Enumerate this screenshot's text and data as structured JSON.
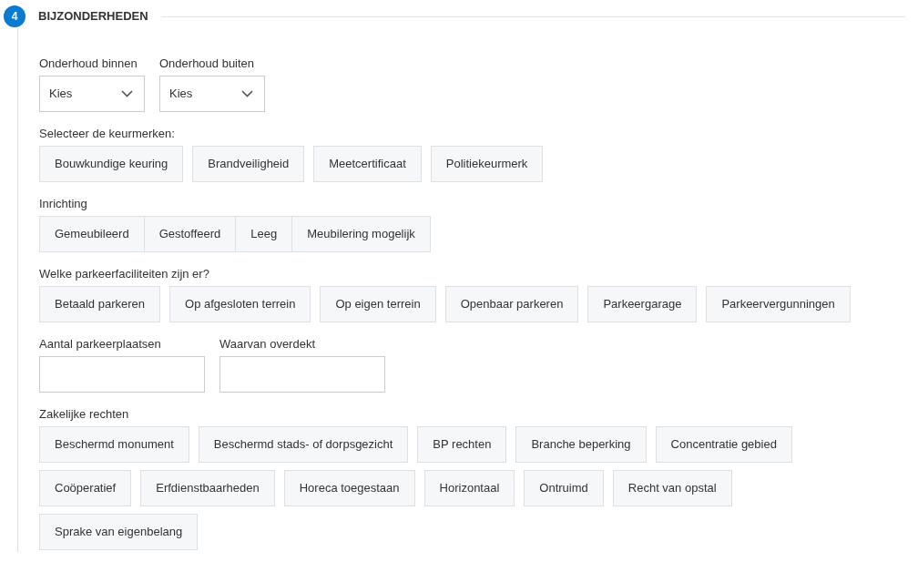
{
  "step": {
    "number": "4",
    "title": "BIJZONDERHEDEN"
  },
  "sections": [
    {
      "kind": "selects",
      "fields": [
        {
          "label": "Onderhoud binnen",
          "value": "Kies"
        },
        {
          "label": "Onderhoud buiten",
          "value": "Kies"
        }
      ]
    },
    {
      "kind": "options",
      "label": "Selecteer de keurmerken:",
      "joined": false,
      "options": [
        {
          "text": "Bouwkundige keuring",
          "selected": false
        },
        {
          "text": "Brandveiligheid",
          "selected": false
        },
        {
          "text": "Meetcertificaat",
          "selected": false
        },
        {
          "text": "Politiekeurmerk",
          "selected": false
        }
      ]
    },
    {
      "kind": "options",
      "label": "Inrichting",
      "joined": true,
      "options": [
        {
          "text": "Gemeubileerd",
          "selected": false
        },
        {
          "text": "Gestoffeerd",
          "selected": false
        },
        {
          "text": "Leeg",
          "selected": false
        },
        {
          "text": "Meubilering mogelijk",
          "selected": false
        }
      ]
    },
    {
      "kind": "options",
      "label": "Welke parkeerfaciliteiten zijn er?",
      "joined": false,
      "options": [
        {
          "text": "Betaald parkeren",
          "selected": false
        },
        {
          "text": "Op afgesloten terrein",
          "selected": false
        },
        {
          "text": "Op eigen terrein",
          "selected": false
        },
        {
          "text": "Openbaar parkeren",
          "selected": false
        },
        {
          "text": "Parkeergarage",
          "selected": false
        },
        {
          "text": "Parkeervergunningen",
          "selected": false
        }
      ]
    },
    {
      "kind": "inputs",
      "fields": [
        {
          "label": "Aantal parkeerplaatsen"
        },
        {
          "label": "Waarvan overdekt"
        }
      ]
    },
    {
      "kind": "options",
      "label": "Zakelijke rechten",
      "joined": false,
      "options": [
        {
          "text": "Beschermd monument",
          "selected": false
        },
        {
          "text": "Beschermd stads- of dorpsgezicht",
          "selected": false
        },
        {
          "text": "BP rechten",
          "selected": false
        },
        {
          "text": "Branche beperking",
          "selected": false
        },
        {
          "text": "Concentratie gebied",
          "selected": false
        },
        {
          "text": "Coöperatief",
          "selected": false
        },
        {
          "text": "Erfdienstbaarheden",
          "selected": false
        },
        {
          "text": "Horeca toegestaan",
          "selected": false
        },
        {
          "text": "Horizontaal",
          "selected": false
        },
        {
          "text": "Ontruimd",
          "selected": false
        },
        {
          "text": "Recht van opstal",
          "selected": false
        },
        {
          "text": "Sprake van eigenbelang",
          "selected": false
        }
      ]
    }
  ]
}
